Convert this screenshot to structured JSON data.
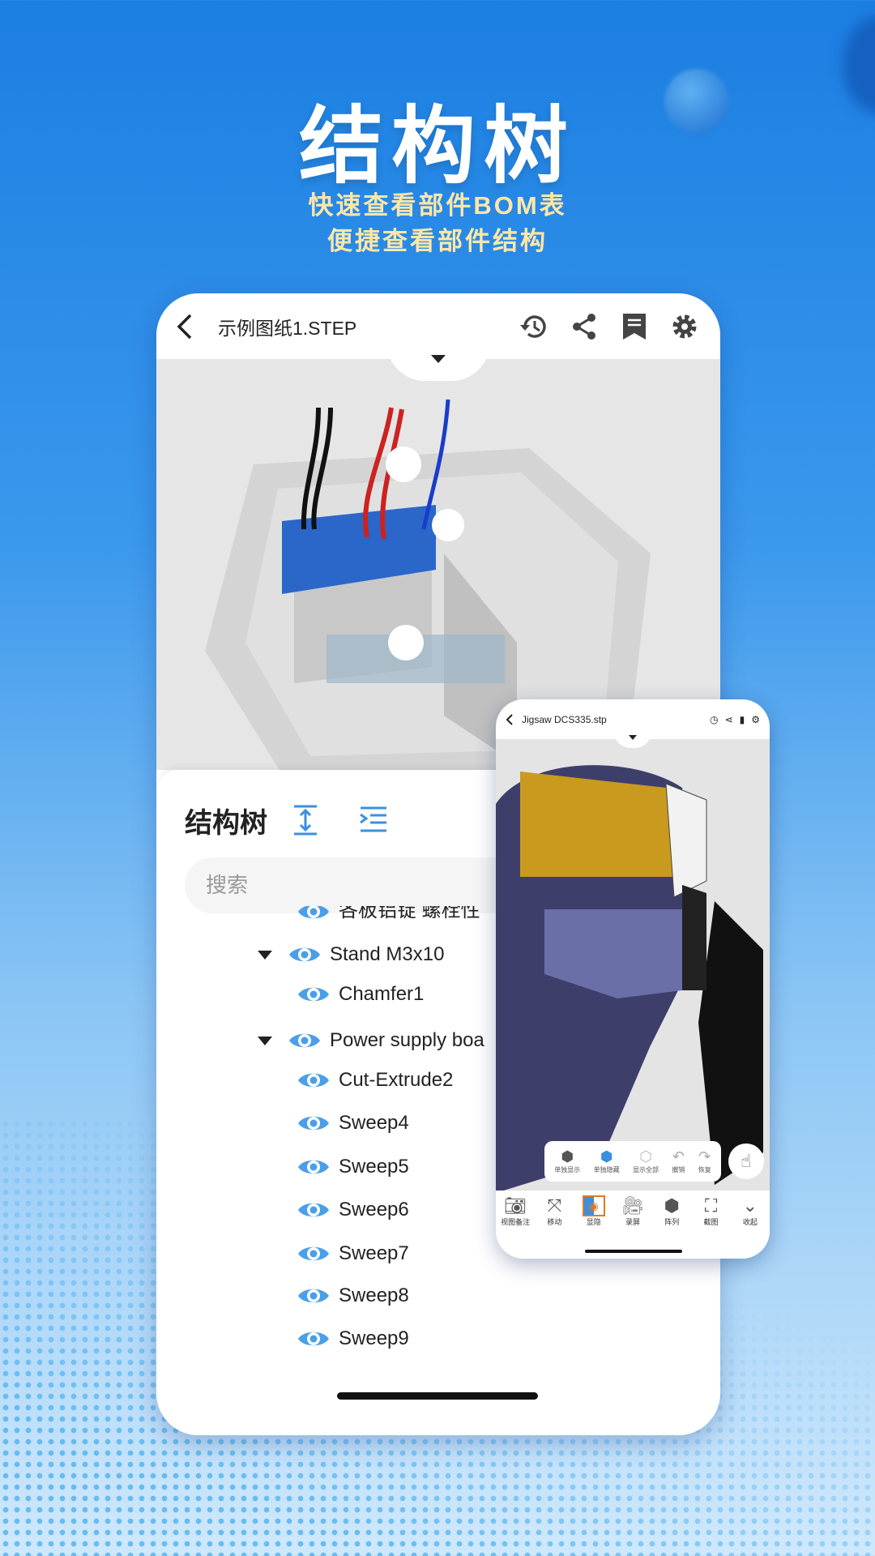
{
  "hero": {
    "title": "结构树",
    "subtitle1": "快速查看部件BOM表",
    "subtitle2": "便捷查看部件结构"
  },
  "main": {
    "file_name": "示例图纸1.STEP",
    "icons": [
      "back-icon",
      "history-icon",
      "share-icon",
      "bookmark-icon",
      "settings-icon"
    ],
    "tree": {
      "title": "结构树",
      "search_placeholder": "搜索",
      "rows": [
        {
          "label": "各板铝锭 螺栓性",
          "level": 2,
          "expandable": false,
          "partial": true
        },
        {
          "label": "Stand M3x10",
          "level": 1,
          "expandable": true
        },
        {
          "label": "Chamfer1",
          "level": 2,
          "expandable": false
        },
        {
          "label": "Power supply  boa",
          "level": 1,
          "expandable": true
        },
        {
          "label": "Cut-Extrude2",
          "level": 2,
          "expandable": false
        },
        {
          "label": "Sweep4",
          "level": 2,
          "expandable": false
        },
        {
          "label": "Sweep5",
          "level": 2,
          "expandable": false
        },
        {
          "label": "Sweep6",
          "level": 2,
          "expandable": false
        },
        {
          "label": "Sweep7",
          "level": 2,
          "expandable": false
        },
        {
          "label": "Sweep8",
          "level": 2,
          "expandable": false
        },
        {
          "label": "Sweep9",
          "level": 2,
          "expandable": false
        }
      ]
    }
  },
  "mini": {
    "file_name": "Jigsaw DCS335.stp",
    "float_tools": [
      "单独显示",
      "单独隐藏",
      "显示全部",
      "撤销",
      "恢复"
    ],
    "bottom_tools": [
      "视图备注",
      "移动",
      "显隐",
      "录屏",
      "阵列",
      "截图",
      "收起"
    ]
  },
  "colors": {
    "accent": "#4a9fe8",
    "active_orange": "#e07a22",
    "subtitle": "#ffe7a6"
  }
}
